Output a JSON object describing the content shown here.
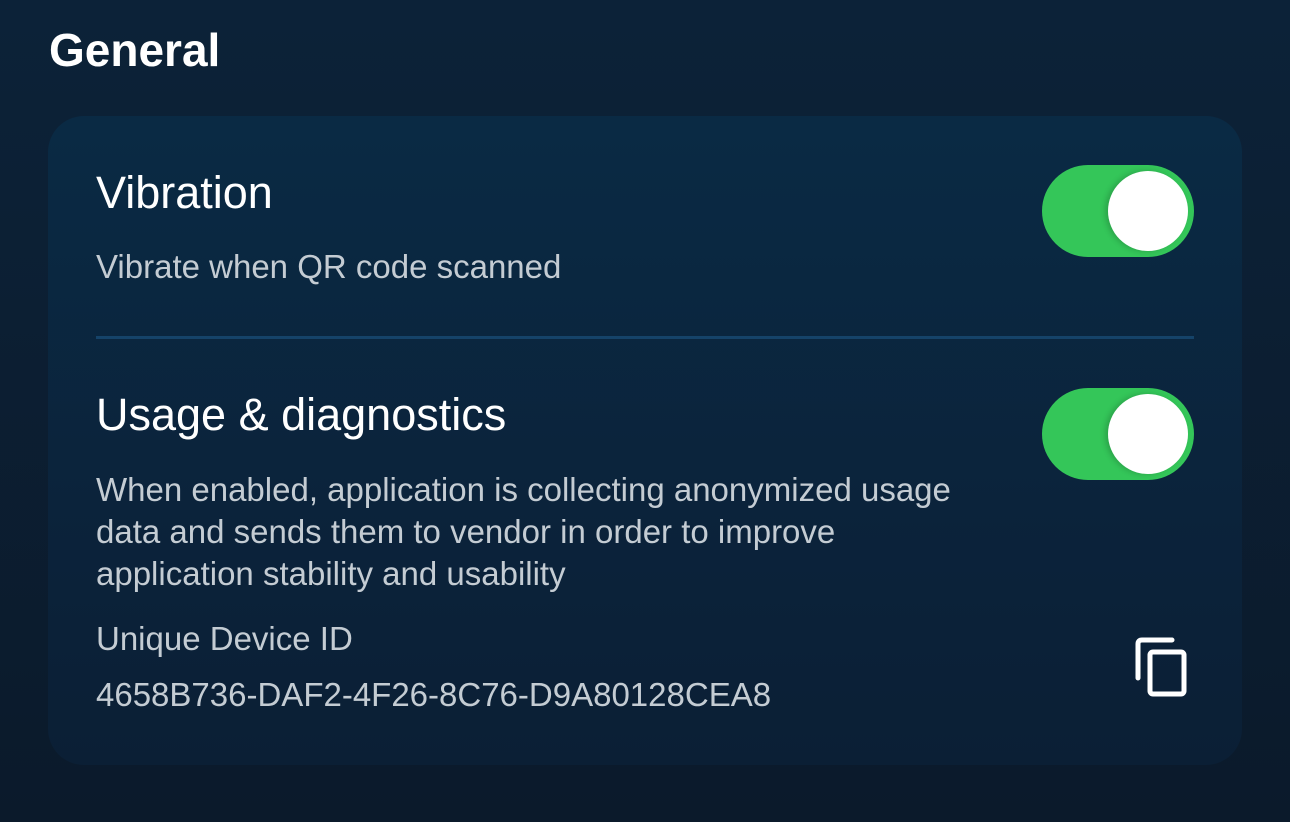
{
  "section": {
    "title": "General"
  },
  "vibration": {
    "title": "Vibration",
    "description": "Vibrate when QR code scanned",
    "enabled": true
  },
  "diagnostics": {
    "title": "Usage & diagnostics",
    "description": "When enabled, application is collecting anonymized usage data and sends them to vendor in order to improve application stability and usability",
    "enabled": true,
    "device_id_label": "Unique Device ID",
    "device_id": "4658B736-DAF2-4F26-8C76-D9A80128CEA8",
    "copy_icon": "copy-icon"
  },
  "colors": {
    "toggle_on": "#34c659",
    "background": "#0b1a2b",
    "card": "#0a2a44",
    "divider": "#154369"
  }
}
